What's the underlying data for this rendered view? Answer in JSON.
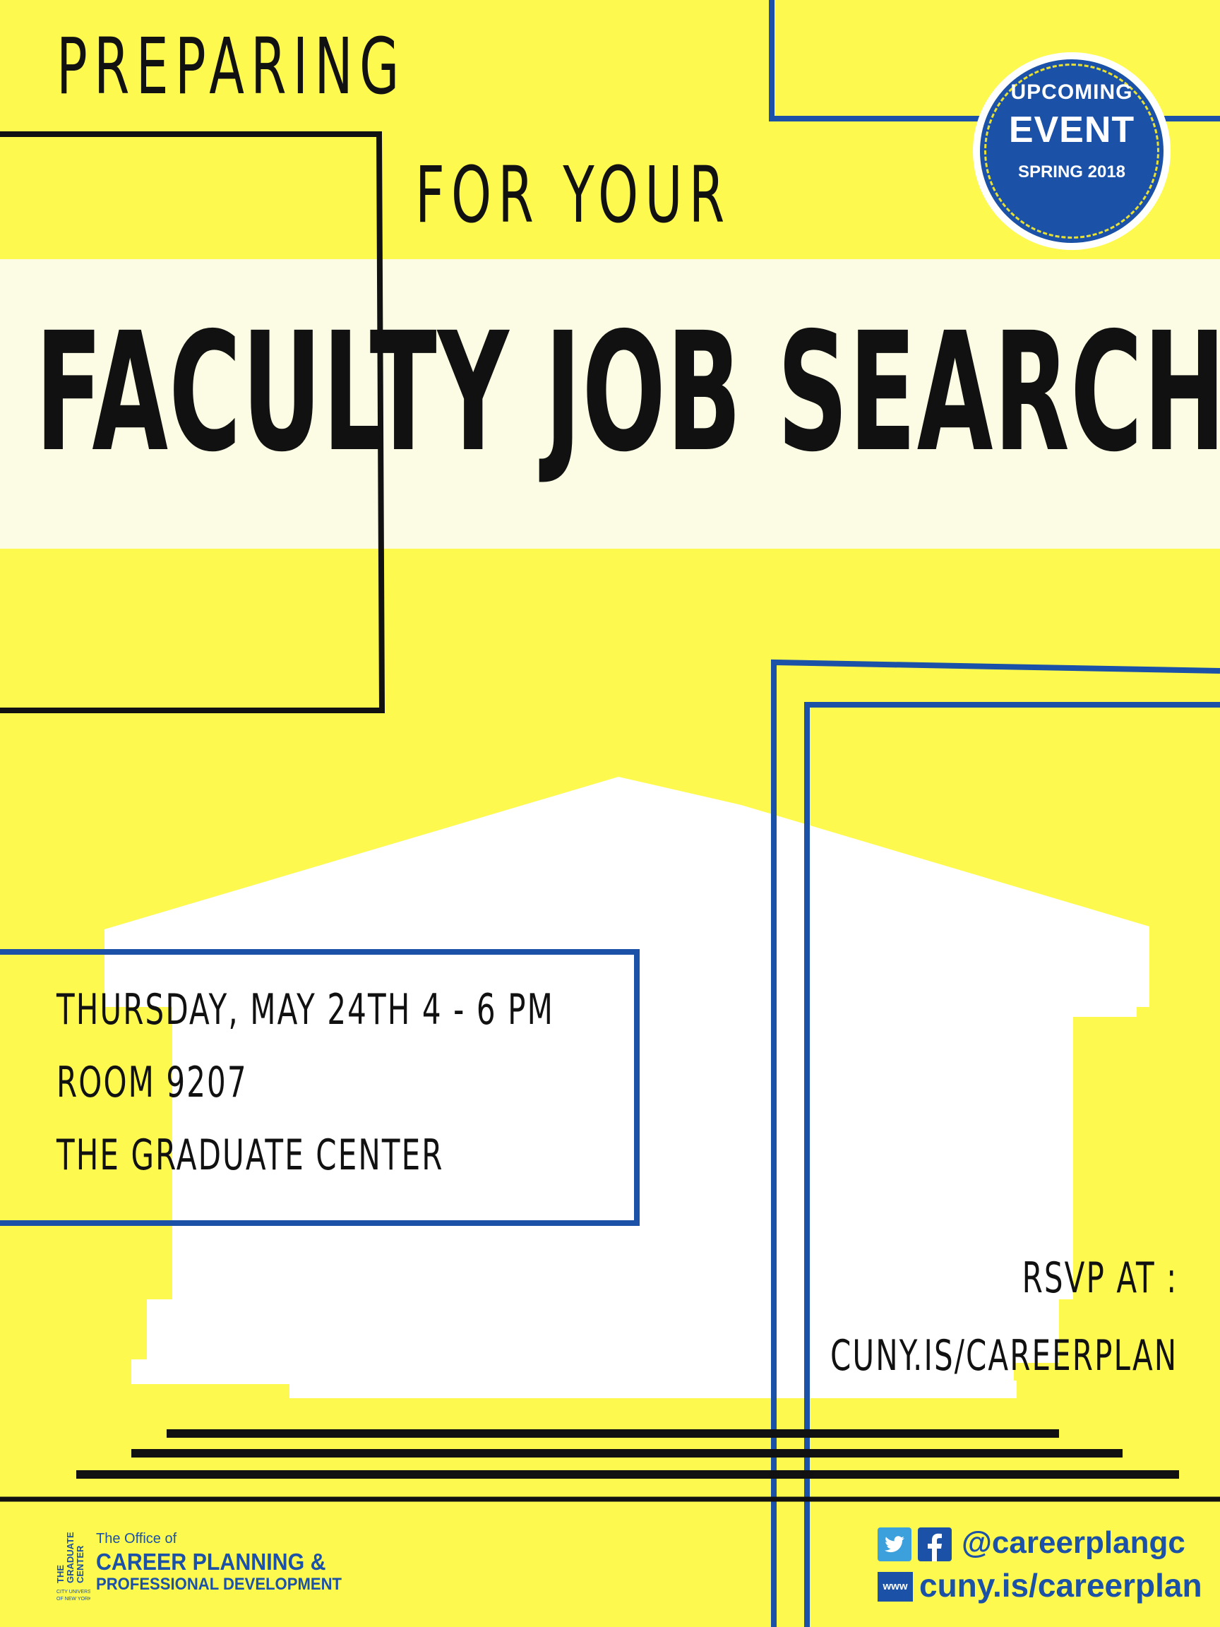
{
  "headline": {
    "line1": "PREPARING",
    "line2": "FOR YOUR",
    "title": "FACULTY JOB SEARCH"
  },
  "badge": {
    "line1": "UPCOMING",
    "line2": "EVENT",
    "line3": "SPRING 2018"
  },
  "details": {
    "datetime": "THURSDAY, MAY 24TH 4 - 6 PM",
    "room": "ROOM 9207",
    "venue": "THE GRADUATE CENTER"
  },
  "rsvp": {
    "label": "RSVP AT :",
    "url": "CUNY.IS/CAREERPLAN"
  },
  "footer": {
    "logo_text": "THE GRADUATE CENTER CITY UNIVERSITY OF NEW YORK",
    "office_line1": "The Office of",
    "office_line2": "CAREER PLANNING &",
    "office_line3": "PROFESSIONAL DEVELOPMENT",
    "social_handle": "@careerplangc",
    "www_label": "www",
    "website": "cuny.is/careerplan"
  },
  "colors": {
    "background": "#fef94f",
    "accent_blue": "#1b51a6",
    "band": "#fcfce4",
    "text": "#111111"
  },
  "icons": [
    "twitter-icon",
    "facebook-icon",
    "www-icon",
    "building-icon"
  ]
}
